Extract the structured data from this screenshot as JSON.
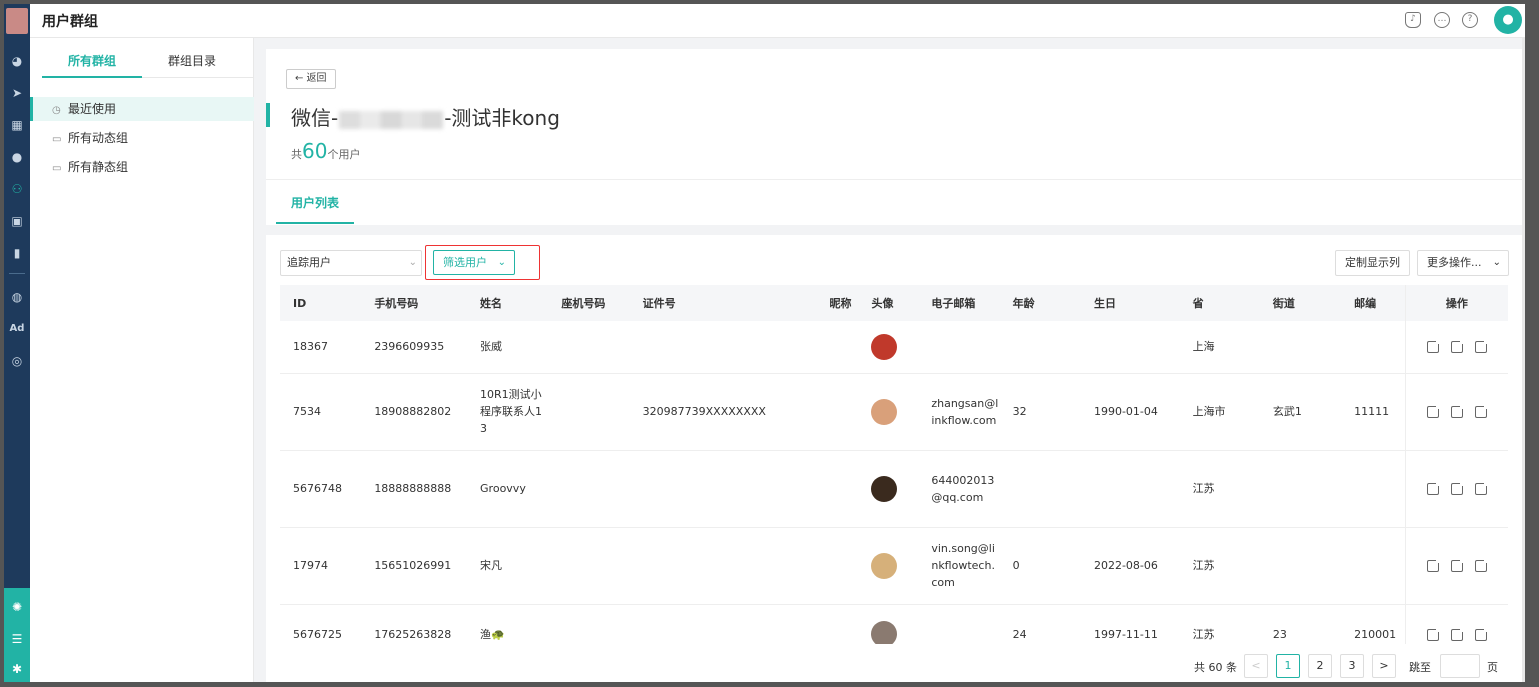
{
  "app": {
    "title": "用户群组"
  },
  "colors": {
    "accent": "#22b3a5",
    "nav": "#1e3a5c",
    "highlight": "#e33333"
  },
  "rail": {
    "icons": [
      "dashboard-icon",
      "send-icon",
      "table-icon",
      "person-icon",
      "group-icon",
      "bookmark-icon",
      "chart-icon",
      "wechat-icon",
      "ad-icon",
      "target-icon"
    ],
    "ad_label": "Ad"
  },
  "sidebar": {
    "tabs": [
      {
        "label": "所有群组",
        "active": true
      },
      {
        "label": "群组目录",
        "active": false
      }
    ],
    "items": [
      {
        "label": "最近使用",
        "icon": "clock-icon",
        "active": true
      },
      {
        "label": "所有动态组",
        "icon": "folder-icon",
        "active": false
      },
      {
        "label": "所有静态组",
        "icon": "folder-icon",
        "active": false
      }
    ]
  },
  "header": {
    "back_label": "← 返回",
    "group_name_prefix": "微信-",
    "group_name_suffix": "-测试非kong",
    "count_prefix": "共",
    "count_value": "60",
    "count_suffix": "个用户"
  },
  "tabs": {
    "user_list": "用户列表"
  },
  "toolbar": {
    "track_select": "追踪用户",
    "filter_label": "筛选用户",
    "custom_columns": "定制显示列",
    "more_actions": "更多操作..."
  },
  "table": {
    "columns": [
      "ID",
      "手机号码",
      "姓名",
      "座机号码",
      "证件号",
      "昵称",
      "头像",
      "电子邮箱",
      "年龄",
      "生日",
      "省",
      "街道",
      "邮编",
      "操作"
    ],
    "rows": [
      {
        "id": "18367",
        "phone": "2396609935",
        "name": "张威",
        "landline": "",
        "idcard": "",
        "nickname": "",
        "avatar": "#c0392b",
        "email": "",
        "age": "",
        "birthday": "",
        "province": "上海",
        "street": "",
        "zip": ""
      },
      {
        "id": "7534",
        "phone": "18908882802",
        "name": "10R1测试小程序联系人13",
        "landline": "",
        "idcard": "320987739XXXXXXXX",
        "nickname": "",
        "avatar": "#d9a07a",
        "email": "zhangsan@linkflow.com",
        "age": "32",
        "birthday": "1990-01-04",
        "province": "上海市",
        "street": "玄武1",
        "zip": "11111"
      },
      {
        "id": "5676748",
        "phone": "18888888888",
        "name": "Groovvy",
        "landline": "",
        "idcard": "",
        "nickname": "",
        "avatar": "#3a2a1e",
        "email": "644002013@qq.com",
        "age": "",
        "birthday": "",
        "province": "江苏",
        "street": "",
        "zip": ""
      },
      {
        "id": "17974",
        "phone": "15651026991",
        "name": "宋凡",
        "landline": "",
        "idcard": "",
        "nickname": "",
        "avatar": "#d6b07a",
        "email": "vin.song@linkflowtech.com",
        "age": "0",
        "birthday": "2022-08-06",
        "province": "江苏",
        "street": "",
        "zip": ""
      },
      {
        "id": "5676725",
        "phone": "17625263828",
        "name": "渔🐢",
        "landline": "",
        "idcard": "",
        "nickname": "",
        "avatar": "#8a7a70",
        "email": "",
        "age": "24",
        "birthday": "1997-11-11",
        "province": "江苏",
        "street": "23",
        "zip": "210001"
      }
    ]
  },
  "pagination": {
    "total_text": "共 60 条",
    "prev": "<",
    "next": ">",
    "pages": [
      "1",
      "2",
      "3"
    ],
    "current": "1",
    "jump_label": "跳至",
    "page_unit": "页"
  }
}
